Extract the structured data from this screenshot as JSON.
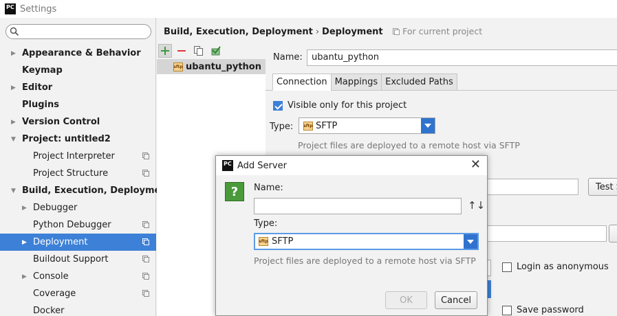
{
  "window": {
    "title": "Settings",
    "app_icon_text": "PC"
  },
  "search": {
    "placeholder": ""
  },
  "sidebar": {
    "items": [
      {
        "label": "Appearance & Behavior",
        "bold": true,
        "arrow": "right"
      },
      {
        "label": "Keymap",
        "bold": true
      },
      {
        "label": "Editor",
        "bold": true,
        "arrow": "right"
      },
      {
        "label": "Plugins",
        "bold": true
      },
      {
        "label": "Version Control",
        "bold": true,
        "arrow": "right"
      },
      {
        "label": "Project: untitled2",
        "bold": true,
        "arrow": "down"
      },
      {
        "label": "Project Interpreter",
        "indent": 1,
        "project_icon": true
      },
      {
        "label": "Project Structure",
        "indent": 1,
        "project_icon": true
      },
      {
        "label": "Build, Execution, Deployment",
        "bold": true,
        "arrow": "down"
      },
      {
        "label": "Debugger",
        "indent": 1,
        "arrow": "right"
      },
      {
        "label": "Python Debugger",
        "indent": 1,
        "project_icon": true
      },
      {
        "label": "Deployment",
        "indent": 1,
        "arrow": "right",
        "project_icon": true,
        "selected": true
      },
      {
        "label": "Buildout Support",
        "indent": 1,
        "project_icon": true
      },
      {
        "label": "Console",
        "indent": 1,
        "arrow": "right",
        "project_icon": true
      },
      {
        "label": "Coverage",
        "indent": 1,
        "project_icon": true
      },
      {
        "label": "Docker",
        "indent": 1
      }
    ]
  },
  "breadcrumb": {
    "parent": "Build, Execution, Deployment",
    "separator": "›",
    "current": "Deployment",
    "scope": "For current project"
  },
  "server_toolbar": {
    "add_icon": "plus-icon",
    "remove_icon": "minus-icon",
    "copy_icon": "copy-icon",
    "default_icon": "check-icon"
  },
  "servers": [
    {
      "label": "ubantu_python",
      "icon_text": "sftp"
    }
  ],
  "config": {
    "name_label": "Name:",
    "name_value": "ubantu_python",
    "tabs": [
      "Connection",
      "Mappings",
      "Excluded Paths"
    ],
    "active_tab": "Connection",
    "visible_only_label": "Visible only for this project",
    "visible_only_checked": true,
    "type_label": "Type:",
    "type_value": "SFTP",
    "type_hint": "Project files are deployed to a remote host via SFTP",
    "test_button": "Test S",
    "login_anonymous_label": "Login as anonymous",
    "save_password_label": "Save password"
  },
  "dialog": {
    "title": "Add Server",
    "name_label": "Name:",
    "name_value": "",
    "type_label": "Type:",
    "type_value": "SFTP",
    "hint": "Project files are deployed to a remote host via SFTP",
    "ok_label": "OK",
    "cancel_label": "Cancel",
    "question_icon": "?",
    "sort_icon": "↑↓"
  },
  "colors": {
    "selection": "#3d80d7",
    "add": "#3c9a3c",
    "remove": "#d9383a"
  }
}
